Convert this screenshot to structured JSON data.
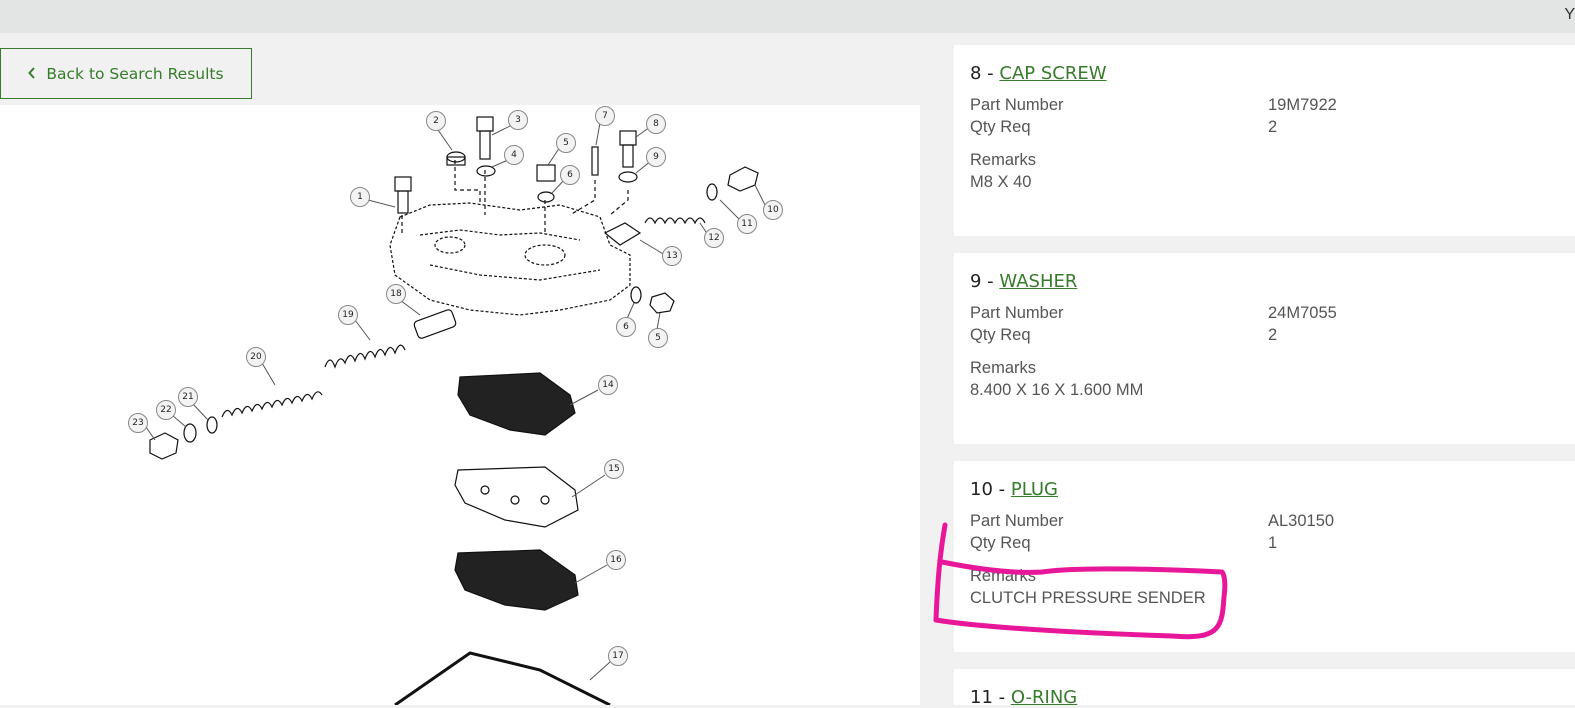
{
  "topbar": {
    "text": "Y"
  },
  "back_button": {
    "label": "Back to Search Results"
  },
  "diagram": {
    "callouts": [
      "1",
      "2",
      "3",
      "4",
      "5",
      "6",
      "7",
      "8",
      "9",
      "10",
      "11",
      "12",
      "13",
      "18",
      "6",
      "5",
      "19",
      "20",
      "14",
      "21",
      "22",
      "23",
      "15",
      "16",
      "17"
    ]
  },
  "parts": [
    {
      "number": "8 - ",
      "name": "CAP SCREW",
      "part_number_label": "Part Number",
      "part_number": "19M7922",
      "qty_label": "Qty Req",
      "qty": "2",
      "remarks_label": "Remarks",
      "remarks": "M8 X 40"
    },
    {
      "number": "9 - ",
      "name": "WASHER",
      "part_number_label": "Part Number",
      "part_number": "24M7055",
      "qty_label": "Qty Req",
      "qty": "2",
      "remarks_label": "Remarks",
      "remarks": "8.400 X 16 X 1.600 MM"
    },
    {
      "number": "10 - ",
      "name": "PLUG",
      "part_number_label": "Part Number",
      "part_number": "AL30150",
      "qty_label": "Qty Req",
      "qty": "1",
      "remarks_label": "Remarks",
      "remarks": "CLUTCH PRESSURE SENDER"
    },
    {
      "number": "11 - ",
      "name": "O-RING"
    }
  ],
  "colors": {
    "accent": "#367c2b",
    "annotation": "#e8179a",
    "background": "#f1f1f1"
  }
}
